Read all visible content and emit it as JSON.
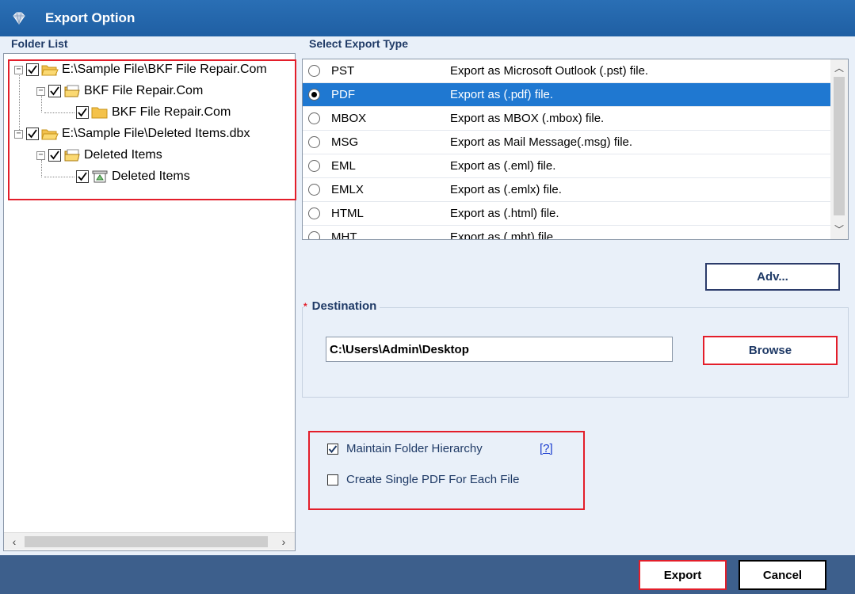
{
  "window": {
    "title": "Export Option"
  },
  "folder_list": {
    "label": "Folder List",
    "tree": [
      {
        "label": "E:\\Sample File\\BKF File Repair.Com",
        "checked": true
      },
      {
        "label": "BKF File Repair.Com",
        "checked": true
      },
      {
        "label": "BKF File Repair.Com",
        "checked": true
      },
      {
        "label": "E:\\Sample File\\Deleted Items.dbx",
        "checked": true
      },
      {
        "label": "Deleted Items",
        "checked": true
      },
      {
        "label": "Deleted Items",
        "checked": true
      }
    ]
  },
  "export_type": {
    "label": "Select Export Type",
    "options": [
      {
        "type": "PST",
        "desc": "Export as Microsoft Outlook (.pst) file."
      },
      {
        "type": "PDF",
        "desc": "Export as (.pdf) file.",
        "selected": true
      },
      {
        "type": "MBOX",
        "desc": "Export as MBOX (.mbox) file."
      },
      {
        "type": "MSG",
        "desc": "Export as Mail Message(.msg) file."
      },
      {
        "type": "EML",
        "desc": "Export as (.eml) file."
      },
      {
        "type": "EMLX",
        "desc": "Export as (.emlx) file."
      },
      {
        "type": "HTML",
        "desc": "Export as (.html) file."
      },
      {
        "type": "MHT",
        "desc": "Export as (.mht) file."
      }
    ]
  },
  "advanced_button": "Adv...",
  "destination": {
    "label": "Destination",
    "required_marker": "*",
    "path": "C:\\Users\\Admin\\Desktop",
    "browse_label": "Browse"
  },
  "options": {
    "maintain_hierarchy": {
      "label": "Maintain Folder Hierarchy",
      "checked": true
    },
    "help_link": "[?]",
    "single_pdf": {
      "label": "Create Single PDF For Each File",
      "checked": false
    }
  },
  "footer": {
    "export_label": "Export",
    "cancel_label": "Cancel"
  },
  "colors": {
    "title_bar": "#2a6fb5",
    "selected_row": "#1f78d1",
    "highlight": "#e31e2a",
    "footer": "#3d5f8c"
  }
}
